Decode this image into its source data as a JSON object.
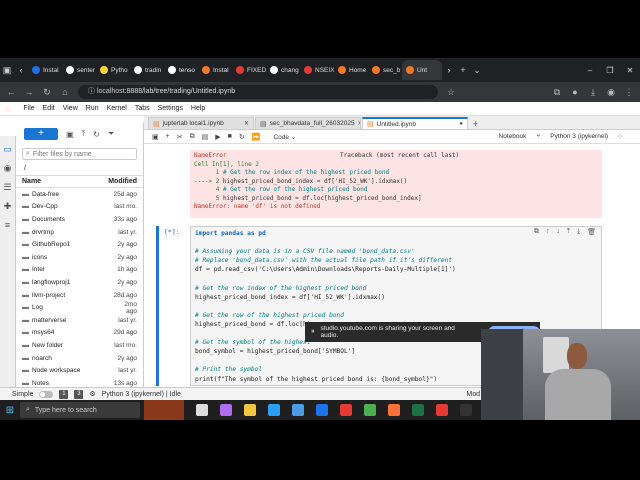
{
  "browser": {
    "tabs": [
      {
        "label": "Instal",
        "color": "#1a73e8"
      },
      {
        "label": "senter",
        "color": "#ffffff"
      },
      {
        "label": "Pytho",
        "color": "#ffd43b"
      },
      {
        "label": "tradin",
        "color": "#ffffff"
      },
      {
        "label": "tenso",
        "color": "#ffffff"
      },
      {
        "label": "Instal",
        "color": "#f37726"
      },
      {
        "label": "FIXED",
        "color": "#e53935"
      },
      {
        "label": "chang",
        "color": "#ffffff"
      },
      {
        "label": "NSEIX",
        "color": "#e53935"
      },
      {
        "label": "Home",
        "color": "#f37726"
      },
      {
        "label": "sec_b",
        "color": "#f37726"
      },
      {
        "label": "Unt",
        "color": "#f37726"
      }
    ],
    "url_host": "localhost",
    "url_rest": ":8888/lab/tree/trading/Untitled.ipynb"
  },
  "jupyter_menu": [
    "File",
    "Edit",
    "View",
    "Run",
    "Kernel",
    "Tabs",
    "Settings",
    "Help"
  ],
  "file_browser": {
    "new_button": "+",
    "search_placeholder": "Filter files by name",
    "path": "/",
    "col_name": "Name",
    "col_modified": "Modified",
    "files": [
      {
        "name": "Data-free",
        "modified": "25d ago"
      },
      {
        "name": "Dev-Cpp",
        "modified": "last mo."
      },
      {
        "name": "Documents",
        "modified": "33s ago"
      },
      {
        "name": "drvrtmp",
        "modified": "last yr."
      },
      {
        "name": "GithubRepo1",
        "modified": "2y ago"
      },
      {
        "name": "icons",
        "modified": "2y ago"
      },
      {
        "name": "Intel",
        "modified": "1h ago"
      },
      {
        "name": "langflowproj1",
        "modified": "2y ago"
      },
      {
        "name": "llvm-project",
        "modified": "28d ago"
      },
      {
        "name": "Log",
        "modified": "2mo ago"
      },
      {
        "name": "matterverse",
        "modified": "last yr."
      },
      {
        "name": "msys64",
        "modified": "29d ago"
      },
      {
        "name": "New folder",
        "modified": "last mo."
      },
      {
        "name": "noarch",
        "modified": "2y ago"
      },
      {
        "name": "Node workspace",
        "modified": "last yr."
      },
      {
        "name": "Notes",
        "modified": "13s ago"
      },
      {
        "name": "ntws",
        "modified": "last yr."
      },
      {
        "name": "PerfLogs",
        "modified": "5y ago"
      }
    ]
  },
  "doc_tabs": [
    {
      "label": "jupterlab local1.ipynb"
    },
    {
      "label": "sec_bhavdata_full_26032025"
    },
    {
      "label": "Untitled.ipynb"
    }
  ],
  "notebook_toolbar": {
    "cell_type": "Code",
    "notebook_label": "Notebook",
    "kernel_label": "Python 3 (ipykernel)"
  },
  "error_output": {
    "name_line": "NameError",
    "traceback_title": "Traceback (most recent call last)",
    "cell_ref": "Cell In[1], line 2",
    "lines": [
      {
        "no": "1",
        "code": "# Get the row index of the highest priced bond"
      },
      {
        "no": "----> 2",
        "code": "highest_priced_bond_index = df['HI_52_WK'].idxmax()"
      },
      {
        "no": "4",
        "code": "# Get the row of the highest priced bond"
      },
      {
        "no": "5",
        "code": "highest_priced_bond = df.loc[highest_priced_bond_index]"
      }
    ],
    "message": "NameError: name 'df' is not defined"
  },
  "cell2": {
    "prompt": "[*]:",
    "lines": [
      "import pandas as pd",
      "",
      "# Assuming your data is in a CSV file named 'bond_data.csv'",
      "# Replace 'bond_data.csv' with the actual file path if it's different",
      "df = pd.read_csv('C:\\Users\\Admin\\Downloads\\Reports-Daily-Multiple[1]')",
      "",
      "# Get the row index of the highest priced bond",
      "highest_priced_bond_index = df['HI_52_WK'].idxmax()",
      "",
      "# Get the row of the highest priced bond",
      "highest_priced_bond = df.loc[hi",
      "",
      "# Get the symbol of the highest",
      "bond_symbol = highest_priced_bond['SYMBOL']",
      "",
      "# Print the symbol",
      "print(f\"The symbol of the highest priced bond is: {bond_symbol}\")"
    ]
  },
  "share_notice": {
    "text": "studio.youtube.com is sharing your screen and audio.",
    "stop_label": "Stop sh"
  },
  "status_bar": {
    "mode": "Simple",
    "num1": "1",
    "num2": "3",
    "kernel_status": "Python 3 (ipykernel) | Idle",
    "right": "Mod"
  },
  "taskbar": {
    "search_placeholder": "Type here to search",
    "apps": [
      {
        "name": "task-view-icon",
        "color": "#dddddd"
      },
      {
        "name": "copilot-icon",
        "color": "#b06cf0"
      },
      {
        "name": "files-icon",
        "color": "#f4c542"
      },
      {
        "name": "edge-icon",
        "color": "#2b9ff5"
      },
      {
        "name": "store-icon",
        "color": "#4c9be8"
      },
      {
        "name": "outlook-icon",
        "color": "#1a73e8"
      },
      {
        "name": "opera-icon",
        "color": "#e53935"
      },
      {
        "name": "terminal-icon",
        "color": "#4caf50"
      },
      {
        "name": "firefox-icon",
        "color": "#ff7139"
      },
      {
        "name": "excel-icon",
        "color": "#1e7145"
      },
      {
        "name": "chrome-icon",
        "color": "#e53935"
      },
      {
        "name": "cmd-icon",
        "color": "#333333"
      },
      {
        "name": "powershell-icon",
        "color": "#5a8bd6"
      }
    ]
  }
}
